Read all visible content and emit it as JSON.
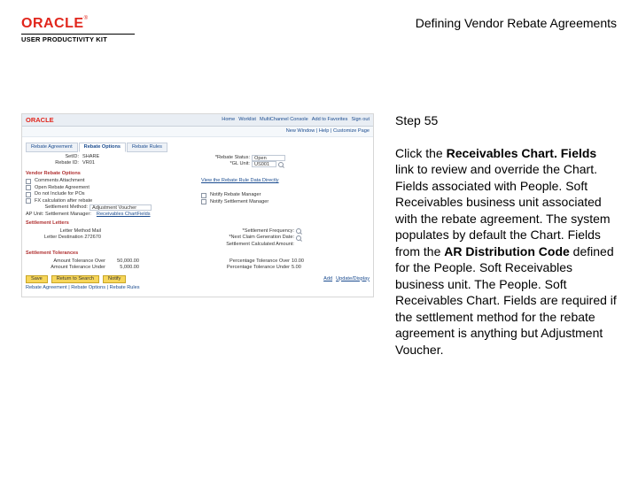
{
  "header": {
    "brand": "ORACLE",
    "brand_tm": "®",
    "product_line": "USER PRODUCTIVITY KIT",
    "doc_title": "Defining Vendor Rebate Agreements"
  },
  "step_label": "Step 55",
  "instruction": {
    "pre": "Click the ",
    "bold1": "Receivables Chart. Fields",
    "post1": " link to review and override the Chart. Fields associated with People. Soft Receivables business unit associated with the rebate agreement. The system populates by default the Chart. Fields from the ",
    "bold2": "AR Distribution Code",
    "post2": " defined for the People. Soft Receivables business unit. The People. Soft Receivables Chart. Fields are required if the settlement method for the rebate agreement is anything but Adjustment Voucher."
  },
  "app": {
    "brand_small": "ORACLE",
    "topnav": [
      "Home",
      "Worklist",
      "MultiChannel Console",
      "Add to Favorites",
      "Sign out"
    ],
    "breadcrumb": "New Window | Help | Customize Page",
    "tabs": [
      "Rebate Agreement",
      "Rebate Options",
      "Rebate Rules"
    ],
    "active_tab": 1,
    "setid_label": "SetID:",
    "setid_value": "SHARE",
    "rebateid_label": "Rebate ID:",
    "rebateid_value": "VR01",
    "status_label": "*Rebate Status:",
    "status_value": "Open",
    "glbu_label": "*GL Unit:",
    "glbu_value": "US001",
    "section_options": "Vendor Rebate Options",
    "opts_left": [
      {
        "label": "Comments Attachment",
        "checked": false
      },
      {
        "label": "Open Rebate Agreement",
        "checked": false
      },
      {
        "label": "Do not Include for POs",
        "checked": false
      }
    ],
    "opt_right_link": "View the Rebate Rule Data Directly",
    "opt_fx": "FX calculation after rebate",
    "settlement_label": "Settlement Method:",
    "settlement_value": "Adjustment Voucher",
    "right_checks": [
      {
        "label": "Notify Rebate Manager",
        "checked": false
      },
      {
        "label": "Notify Settlement Manager",
        "checked": false
      }
    ],
    "ap_line": "AP Unit:   Settlement Manager:",
    "ap_link": "Receivables ChartFields",
    "section_letters": "Settlement Letters",
    "lt_rows": [
      {
        "l": "Letter Method Mail",
        "r": "*Settlement Frequency:"
      },
      {
        "l": "Letter Destination 272670",
        "r": "*Next Claim Generation Date:"
      },
      {
        "l": "",
        "r": "Settlement Calculated Amount:"
      }
    ],
    "section_tol": "Settlement Tolerances",
    "tol_rows": [
      {
        "l": "Amount Tolerance Over",
        "lv": "50,000.00",
        "r": "Percentage Tolerance Over",
        "rv": "10.00"
      },
      {
        "l": "Amount Tolerance Under",
        "lv": "5,000.00",
        "r": "Percentage Tolerance Under",
        "rv": "5.00"
      }
    ],
    "buttons": {
      "save": "Save",
      "return": "Return to Search",
      "notify": "Notify"
    },
    "bottom_links": [
      "Add",
      "Update/Display"
    ],
    "footer_links": "Rebate Agreement | Rebate Options | Rebate Rules"
  }
}
